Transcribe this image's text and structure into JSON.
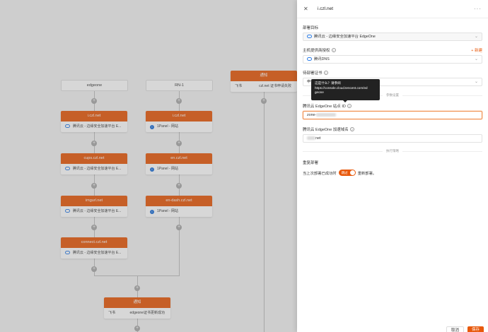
{
  "workflow": {
    "start_nodes": [
      "edgeone",
      "RN-1"
    ],
    "column1": [
      {
        "title": "i.czl.net",
        "provider": "腾讯云 - 边缘安全加速平台 E..."
      },
      {
        "title": "cups.czl.net",
        "provider": "腾讯云 - 边缘安全加速平台 E..."
      },
      {
        "title": "imgurl.net",
        "provider": "腾讯云 - 边缘安全加速平台 E..."
      },
      {
        "title": "connect.czl.net",
        "provider": "腾讯云 - 边缘安全加速平台 E..."
      }
    ],
    "column2": [
      {
        "title": "i.czl.net",
        "provider": "1Panel - 网站"
      },
      {
        "title": "en.czl.net",
        "provider": "1Panel - 网站"
      },
      {
        "title": "en-dash.czl.net",
        "provider": "1Panel - 网站"
      }
    ],
    "notify_top": {
      "title": "通知",
      "channel": "飞书",
      "message": "czl.net 证书申请失败"
    },
    "notify_bottom": {
      "title": "通知",
      "channel": "飞书",
      "message": "edgeone证书更新成功"
    }
  },
  "drawer": {
    "title": "i.czl.net",
    "more": "···",
    "deploy_target_label": "部署目标",
    "deploy_target_value": "腾讯云 - 边缘安全加速平台 EdgeOne",
    "host_auth_label": "主机提供商授权",
    "add_new": "+ 新建",
    "host_auth_value": "腾讯DNS",
    "cert_label": "待部署证书",
    "cert_value": "申请",
    "params_divider": "参数设置",
    "zone_label": "腾讯云 EdgeOne 站点 ID",
    "zone_value": "zone-",
    "domain_label": "腾讯云 EdgeOne 加速域名",
    "domain_value": "net",
    "strategy_divider": "执行策略",
    "redeploy_label": "重复部署",
    "redeploy_prefix": "当上次部署已成功时",
    "toggle_text": "跳过",
    "redeploy_suffix": "重新部署。",
    "tooltip_line1": "这是什么？请参阅",
    "tooltip_line2": "https://console.cloud.tencent.com/ed",
    "tooltip_line3": "geone",
    "cancel": "取消",
    "save": "保存"
  },
  "colors": {
    "accent": "#e8590c",
    "overlay": "#8c8c8c"
  }
}
